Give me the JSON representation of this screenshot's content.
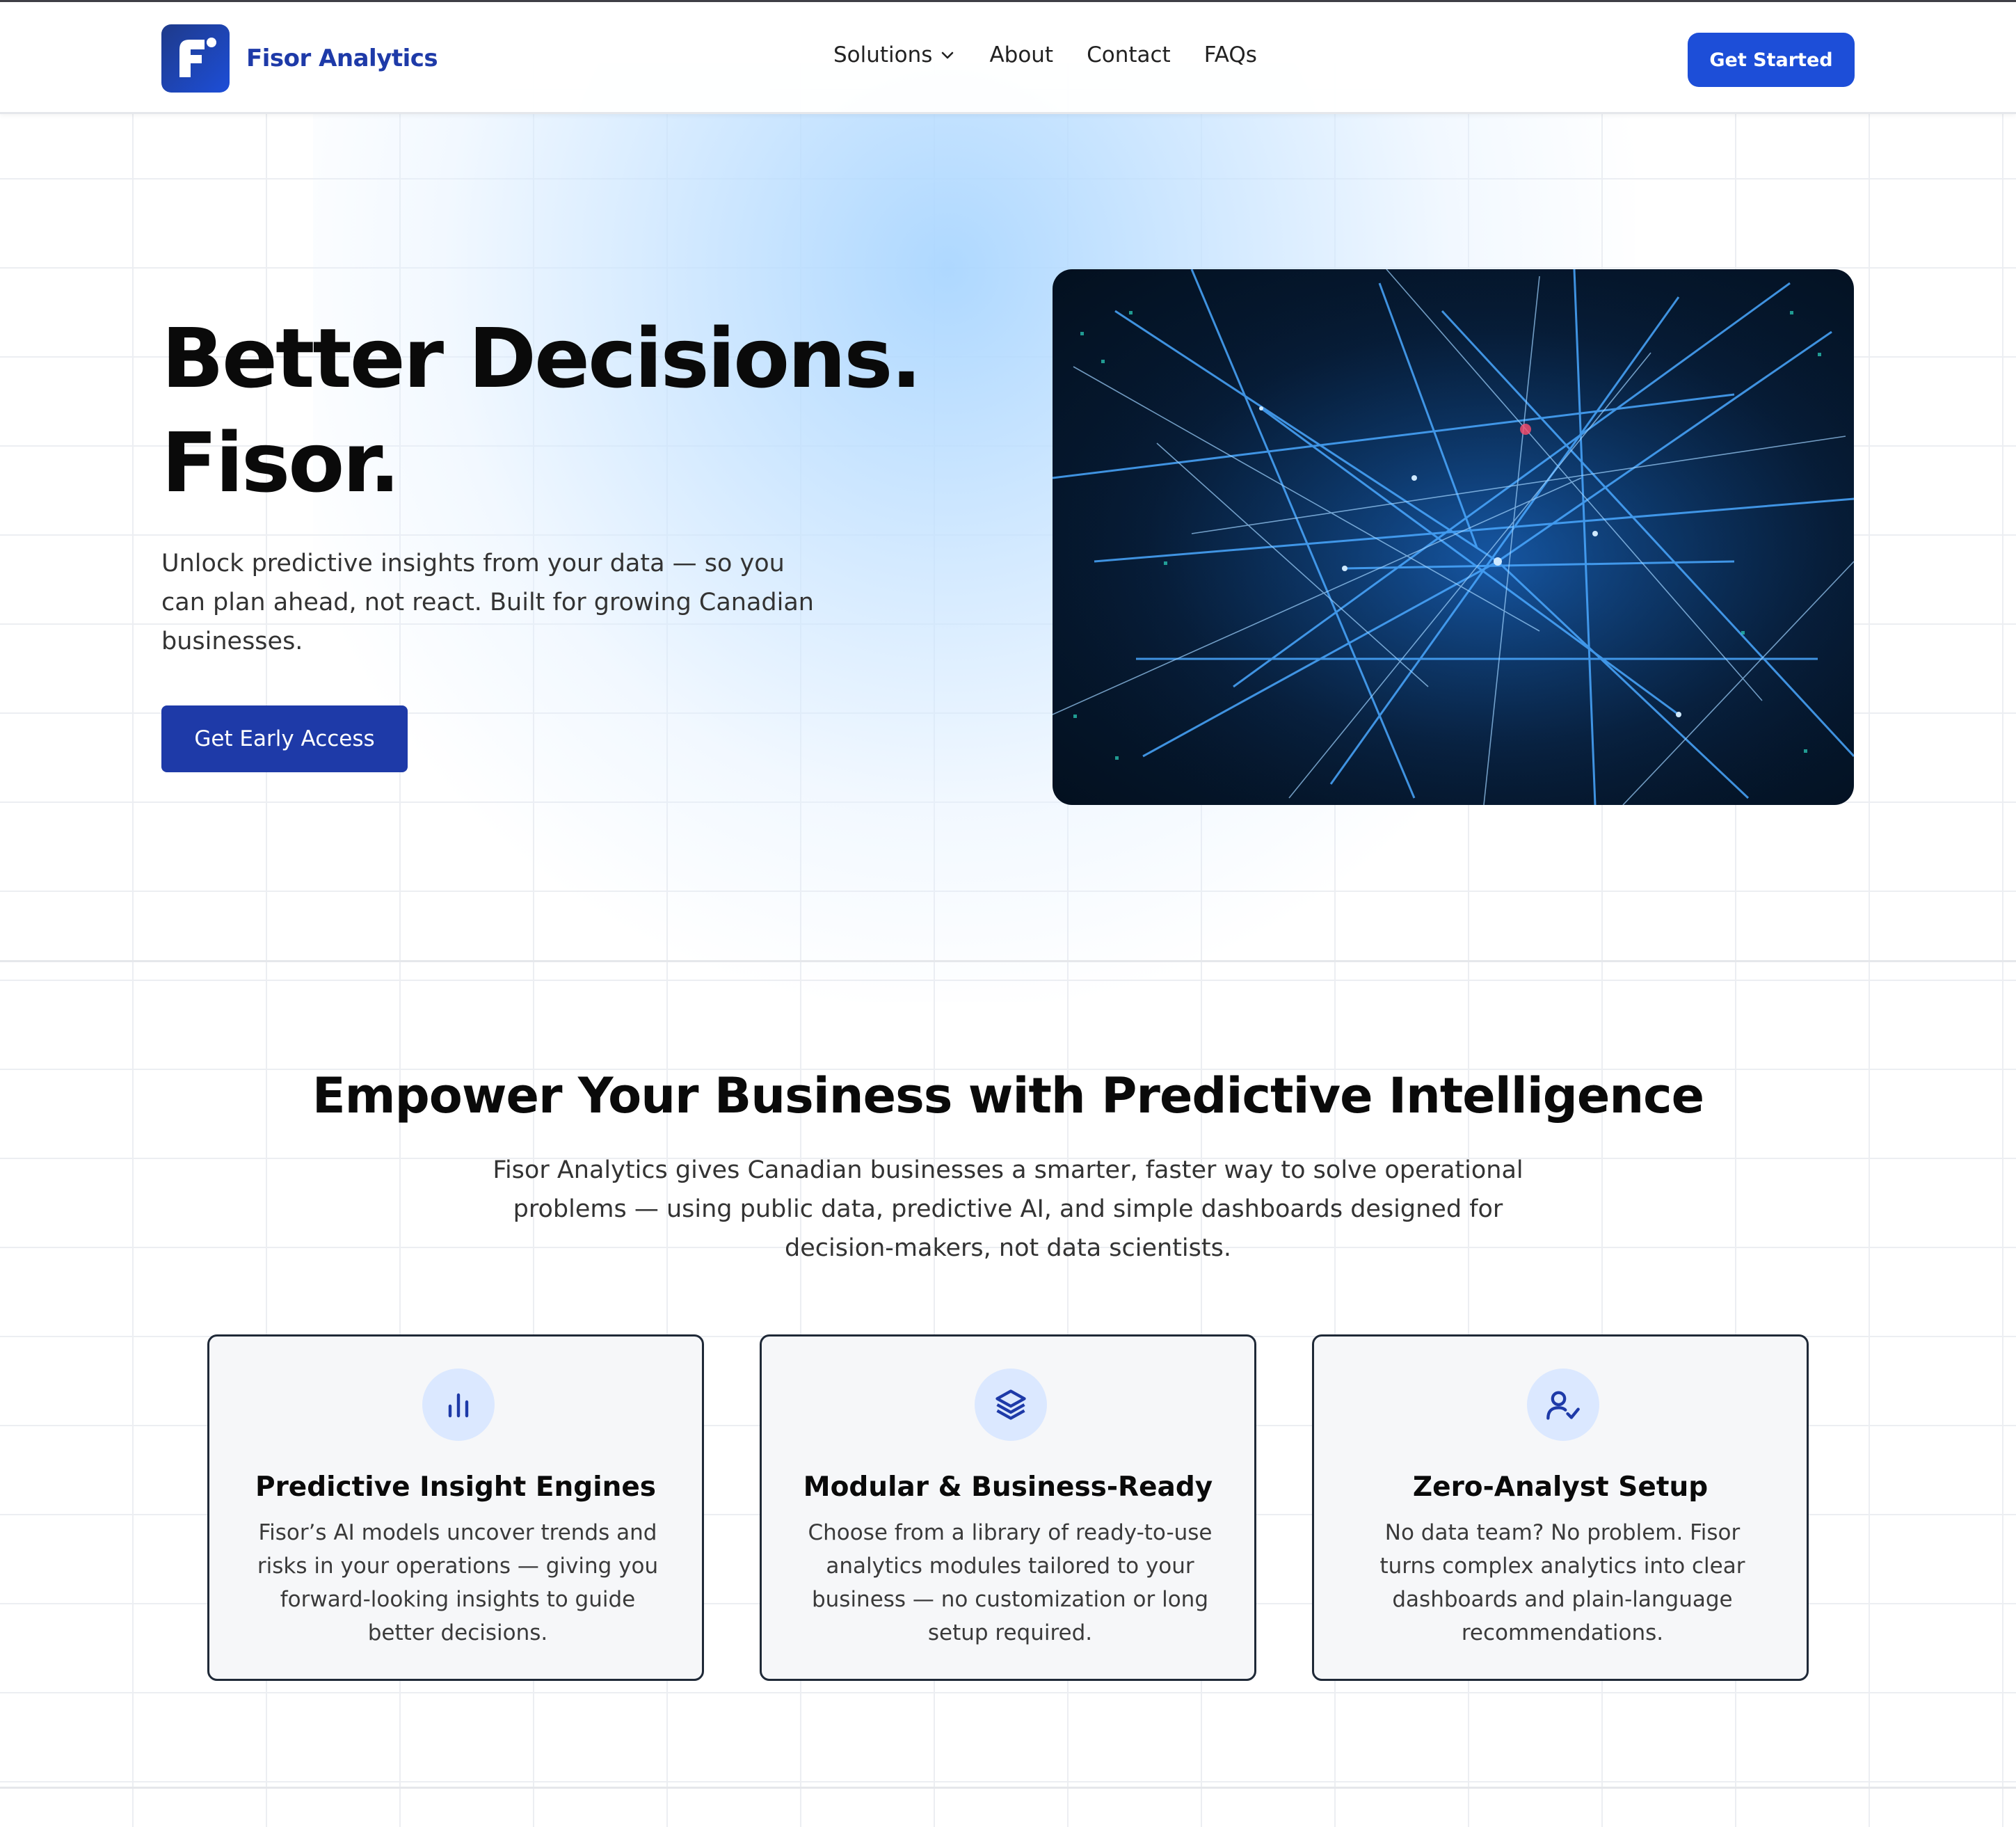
{
  "header": {
    "brand": "Fisor Analytics",
    "nav": [
      {
        "label": "Solutions",
        "has_dropdown": true
      },
      {
        "label": "About"
      },
      {
        "label": "Contact"
      },
      {
        "label": "FAQs"
      }
    ],
    "cta": "Get Started"
  },
  "hero": {
    "title_line1": "Better Decisions.",
    "title_line2": "Fisor.",
    "subtitle": "Unlock predictive insights from your data — so you can plan ahead, not react. Built for growing Canadian businesses.",
    "cta": "Get Early Access"
  },
  "features_section": {
    "title": "Empower Your Business with Predictive Intelligence",
    "description": "Fisor Analytics gives Canadian businesses a smarter, faster way to solve operational problems — using public data, predictive AI, and simple dashboards designed for decision-makers, not data scientists.",
    "cards": [
      {
        "icon": "bar-chart-icon",
        "title": "Predictive Insight Engines",
        "body": "Fisor’s AI models uncover trends and risks in your operations — giving you forward-looking insights to guide better decisions."
      },
      {
        "icon": "layers-icon",
        "title": "Modular & Business-Ready",
        "body": "Choose from a library of ready-to-use analytics modules tailored to your business — no customization or long setup required."
      },
      {
        "icon": "user-check-icon",
        "title": "Zero-Analyst Setup",
        "body": "No data team? No problem. Fisor turns complex analytics into clear dashboards and plain-language recommendations."
      }
    ]
  },
  "colors": {
    "brand_blue": "#1d4ed8",
    "brand_dark_blue": "#1e3aa8",
    "icon_bg": "#dbe8ff",
    "card_bg": "#f6f7f9"
  }
}
